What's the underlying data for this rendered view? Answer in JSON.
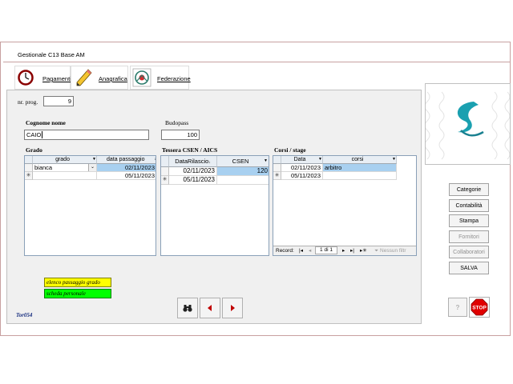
{
  "app": {
    "title": "Gestionale C13 Base AM"
  },
  "tabs": [
    {
      "label": "Pagamenti"
    },
    {
      "label": "Anagrafica"
    },
    {
      "label": "Federazione"
    }
  ],
  "form": {
    "nr_prog_label": "nr. prog.",
    "nr_prog_value": "9",
    "cognome_label": "Cognome nome",
    "cognome_value": "CAIO",
    "budopass_label": "Budopass",
    "budopass_value": "100"
  },
  "grado": {
    "section_label": "Grado",
    "columns": [
      "grado",
      "data passaggio"
    ],
    "rows": [
      {
        "grado": "bianca",
        "data": "02/11/2023"
      },
      {
        "grado": "",
        "data": "05/11/2023"
      }
    ]
  },
  "tessera": {
    "section_label": "Tessera CSEN / AICS",
    "columns": [
      "DataRilascio",
      "CSEN"
    ],
    "rows": [
      {
        "data": "02/11/2023",
        "csen": "120"
      },
      {
        "data": "05/11/2023",
        "csen": ""
      }
    ]
  },
  "corsi": {
    "section_label": "Corsi / stage",
    "columns": [
      "Data",
      "corsi"
    ],
    "rows": [
      {
        "data": "02/11/2023",
        "corso": "arbitro"
      },
      {
        "data": "05/11/2023",
        "corso": ""
      }
    ],
    "nav": {
      "record_label": "Record:",
      "position": "1 di 1",
      "filter_label": "Nessun filtr"
    }
  },
  "actions": {
    "elenco_label": "elenco passaggio grado",
    "scheda_label": "scheda personale",
    "footer_code": "Tor054"
  },
  "right_buttons": [
    {
      "label": "Categorie"
    },
    {
      "label": "Contabilità"
    },
    {
      "label": "Stampa"
    },
    {
      "label": "Fornitori"
    },
    {
      "label": "Collaboratori"
    },
    {
      "label": "SALVA"
    }
  ],
  "stop_label": "STOP",
  "colors": {
    "yellow_button": "#ffff00",
    "green_button": "#00ff00",
    "stop_red": "#e00000",
    "selection": "#a8d0f0"
  }
}
